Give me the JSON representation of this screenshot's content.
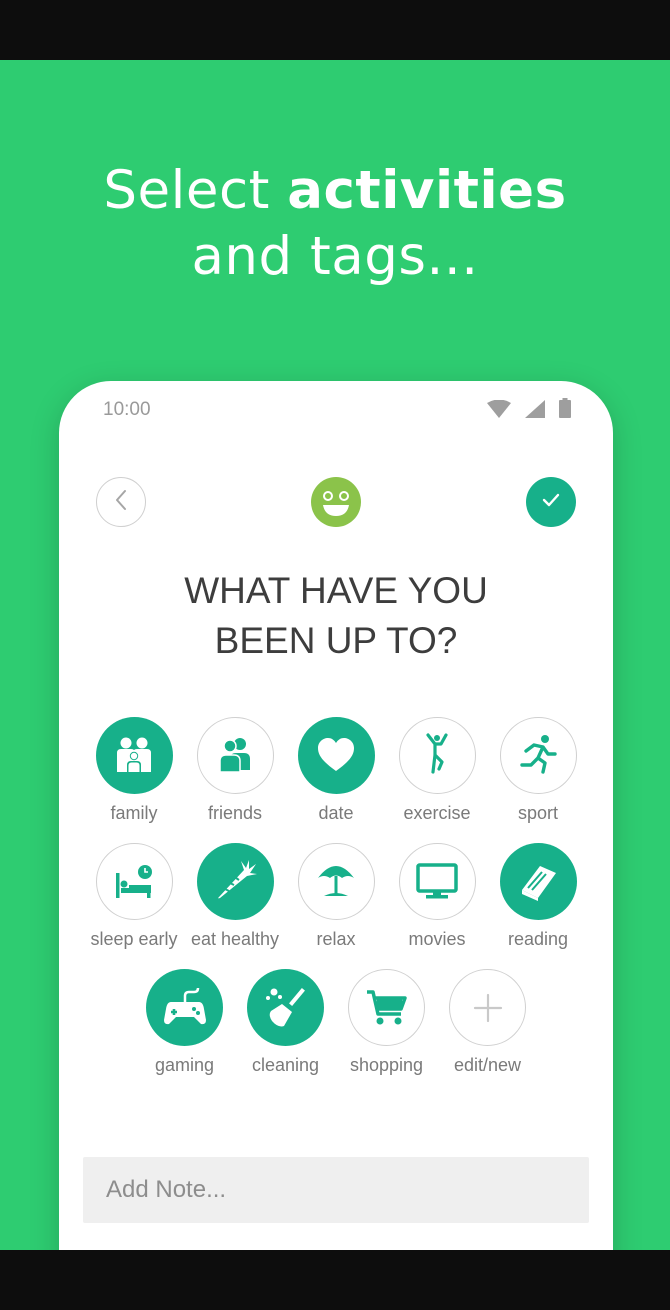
{
  "headline": {
    "line1_regular": "Select",
    "line1_bold": "activities",
    "line2": "and tags..."
  },
  "status": {
    "time": "10:00"
  },
  "question": {
    "line1": "WHAT HAVE YOU",
    "line2": "BEEN UP TO?"
  },
  "activities": [
    {
      "label": "family",
      "icon": "family-icon",
      "selected": true
    },
    {
      "label": "friends",
      "icon": "friends-icon",
      "selected": false
    },
    {
      "label": "date",
      "icon": "heart-icon",
      "selected": true
    },
    {
      "label": "exercise",
      "icon": "exercise-icon",
      "selected": false
    },
    {
      "label": "sport",
      "icon": "running-icon",
      "selected": false
    },
    {
      "label": "sleep early",
      "icon": "bed-clock-icon",
      "selected": false
    },
    {
      "label": "eat healthy",
      "icon": "carrot-icon",
      "selected": true
    },
    {
      "label": "relax",
      "icon": "beach-umbrella-icon",
      "selected": false
    },
    {
      "label": "movies",
      "icon": "tv-icon",
      "selected": false
    },
    {
      "label": "reading",
      "icon": "book-icon",
      "selected": true
    },
    {
      "label": "gaming",
      "icon": "gamepad-icon",
      "selected": true
    },
    {
      "label": "cleaning",
      "icon": "broom-icon",
      "selected": true
    },
    {
      "label": "shopping",
      "icon": "cart-icon",
      "selected": false
    },
    {
      "label": "edit/new",
      "icon": "plus-icon",
      "selected": false
    }
  ],
  "note": {
    "placeholder": "Add Note..."
  },
  "colors": {
    "background": "#2ecc71",
    "accent": "#17b08a",
    "mood": "#8bc34a"
  }
}
